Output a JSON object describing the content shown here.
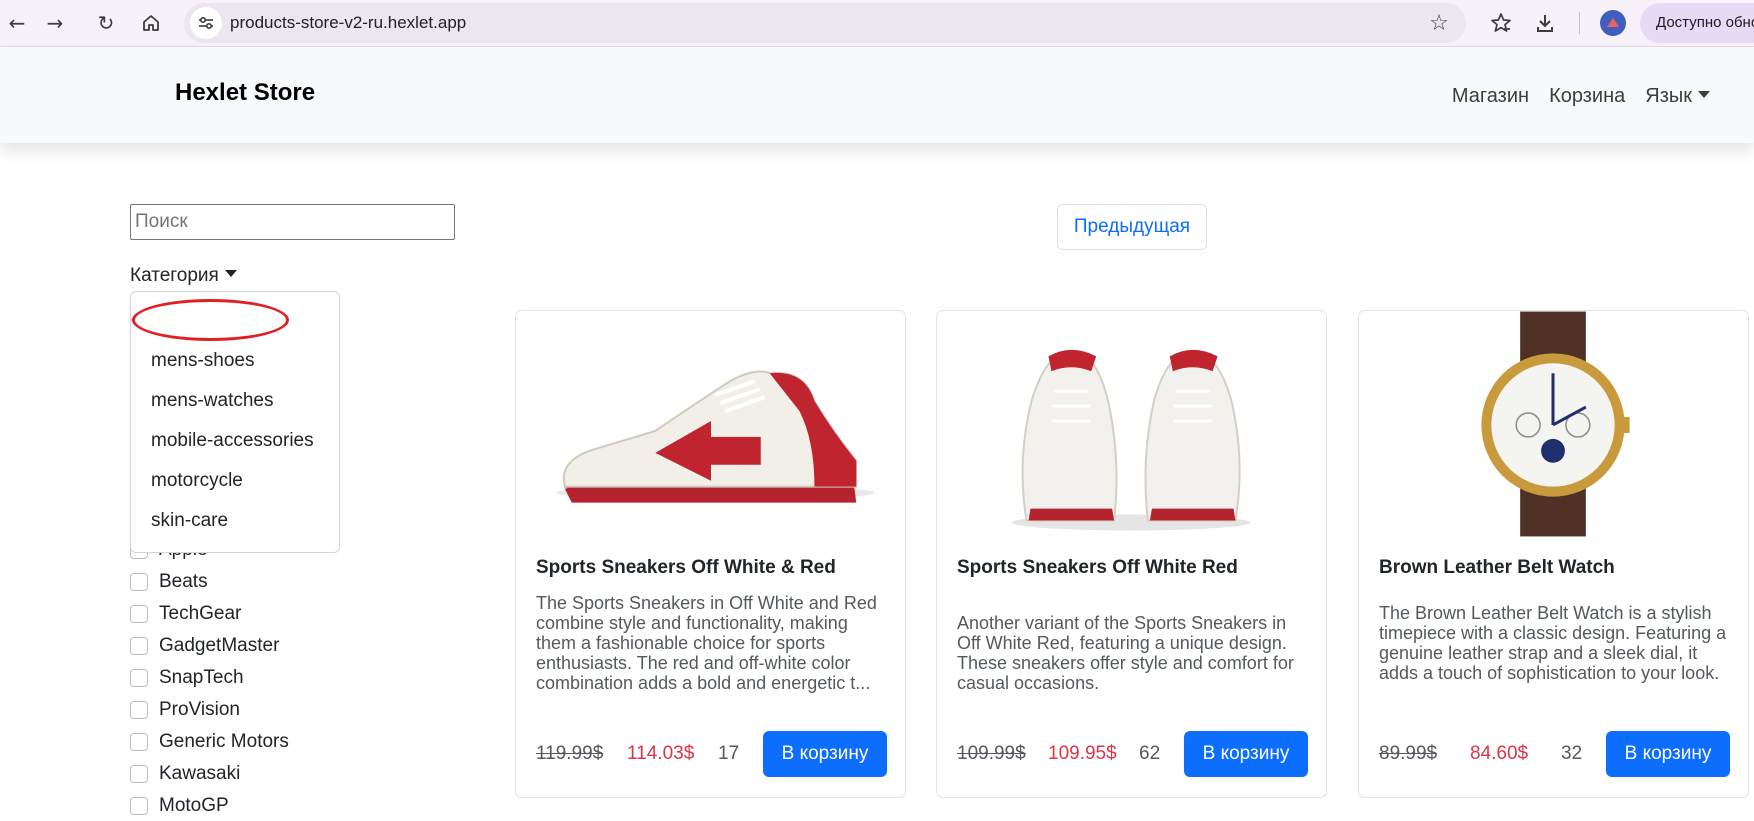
{
  "browser": {
    "url": "products-store-v2-ru.hexlet.app",
    "update_label": "Доступно обновление"
  },
  "navbar": {
    "brand": "Hexlet Store",
    "links": [
      "Магазин",
      "Корзина",
      "Язык"
    ]
  },
  "sidebar": {
    "search": {
      "placeholder": "Поиск",
      "value": ""
    },
    "category_label": "Категория",
    "category_options": [
      "",
      "mens-shoes",
      "mens-watches",
      "mobile-accessories",
      "motorcycle",
      "skin-care"
    ],
    "brands_partial": "Apple",
    "brands": [
      "Beats",
      "TechGear",
      "GadgetMaster",
      "SnapTech",
      "ProVision",
      "Generic Motors",
      "Kawasaki",
      "MotoGP"
    ]
  },
  "pagination": {
    "prev_label": "Предыдущая"
  },
  "products": [
    {
      "title": "Sports Sneakers Off White & Red",
      "description": "The Sports Sneakers in Off White and Red combine style and functionality, making them a fashionable choice for sports enthusiasts. The red and off-white color combination adds a bold and energetic t...",
      "old_price": "119.99$",
      "price": "114.03$",
      "stock": "17",
      "button": "В корзину"
    },
    {
      "title": "Sports Sneakers Off White Red",
      "description": "Another variant of the Sports Sneakers in Off White Red, featuring a unique design. These sneakers offer style and comfort for casual occasions.",
      "old_price": "109.99$",
      "price": "109.95$",
      "stock": "62",
      "button": "В корзину"
    },
    {
      "title": "Brown Leather Belt Watch",
      "description": "The Brown Leather Belt Watch is a stylish timepiece with a classic design. Featuring a genuine leather strap and a sleek dial, it adds a touch of sophistication to your look.",
      "old_price": "89.99$",
      "price": "84.60$",
      "stock": "32",
      "button": "В корзину"
    }
  ],
  "colors": {
    "primary": "#0d6efd",
    "sale_price": "#dc3545",
    "highlight": "#e31e24",
    "navbar_bg": "#f8f9fa"
  }
}
